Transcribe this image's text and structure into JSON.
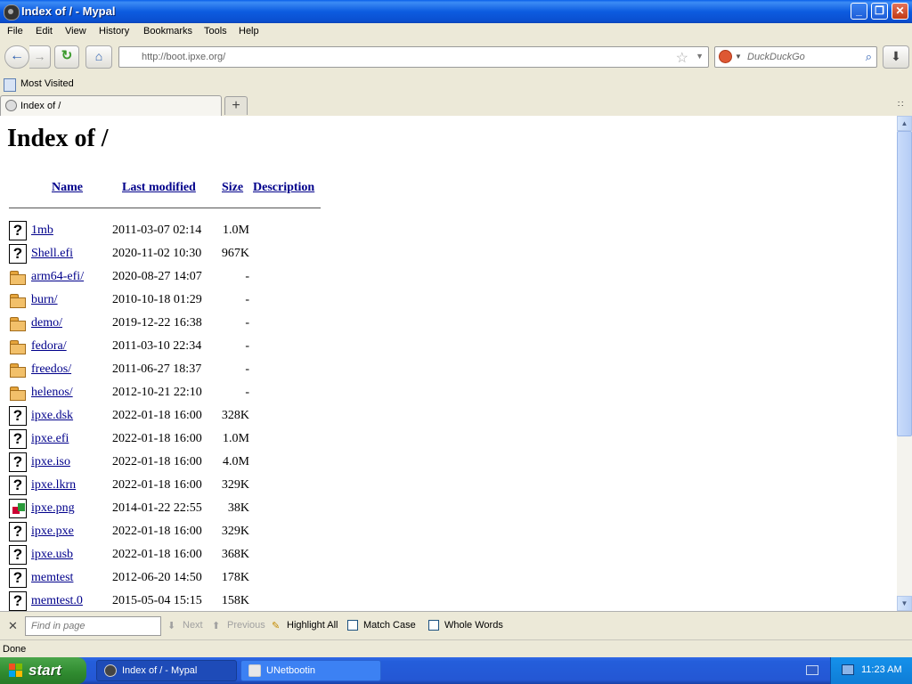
{
  "window": {
    "title": "Index of / - Mypal"
  },
  "menu": [
    "File",
    "Edit",
    "View",
    "History",
    "Bookmarks",
    "Tools",
    "Help"
  ],
  "navbar": {
    "url": "http://boot.ipxe.org/",
    "search_placeholder": "DuckDuckGo"
  },
  "bookmarks": {
    "most_visited": "Most Visited"
  },
  "tabs": [
    {
      "label": "Index of /"
    }
  ],
  "page": {
    "heading": "Index of /",
    "columns": {
      "name": "Name",
      "modified": "Last modified",
      "size": "Size",
      "description": "Description"
    },
    "rows": [
      {
        "icon": "file-icon",
        "name": "1mb",
        "date": "2011-03-07 02:14",
        "size": "1.0M"
      },
      {
        "icon": "file-icon",
        "name": "Shell.efi",
        "date": "2020-11-02 10:30",
        "size": "967K"
      },
      {
        "icon": "folder-icon",
        "name": "arm64-efi/",
        "date": "2020-08-27 14:07",
        "size": "-"
      },
      {
        "icon": "folder-icon",
        "name": "burn/",
        "date": "2010-10-18 01:29",
        "size": "-"
      },
      {
        "icon": "folder-icon",
        "name": "demo/",
        "date": "2019-12-22 16:38",
        "size": "-"
      },
      {
        "icon": "folder-icon",
        "name": "fedora/",
        "date": "2011-03-10 22:34",
        "size": "-"
      },
      {
        "icon": "folder-icon",
        "name": "freedos/",
        "date": "2011-06-27 18:37",
        "size": "-"
      },
      {
        "icon": "folder-icon",
        "name": "helenos/",
        "date": "2012-10-21 22:10",
        "size": "-"
      },
      {
        "icon": "file-icon",
        "name": "ipxe.dsk",
        "date": "2022-01-18 16:00",
        "size": "328K"
      },
      {
        "icon": "file-icon",
        "name": "ipxe.efi",
        "date": "2022-01-18 16:00",
        "size": "1.0M"
      },
      {
        "icon": "file-icon",
        "name": "ipxe.iso",
        "date": "2022-01-18 16:00",
        "size": "4.0M"
      },
      {
        "icon": "file-icon",
        "name": "ipxe.lkrn",
        "date": "2022-01-18 16:00",
        "size": "329K"
      },
      {
        "icon": "image-icon",
        "name": "ipxe.png",
        "date": "2014-01-22 22:55",
        "size": "38K"
      },
      {
        "icon": "file-icon",
        "name": "ipxe.pxe",
        "date": "2022-01-18 16:00",
        "size": "329K"
      },
      {
        "icon": "file-icon",
        "name": "ipxe.usb",
        "date": "2022-01-18 16:00",
        "size": "368K"
      },
      {
        "icon": "file-icon",
        "name": "memtest",
        "date": "2012-06-20 14:50",
        "size": "178K"
      },
      {
        "icon": "file-icon",
        "name": "memtest.0",
        "date": "2015-05-04 15:15",
        "size": "158K"
      }
    ]
  },
  "findbar": {
    "placeholder": "Find in page",
    "next": "Next",
    "previous": "Previous",
    "highlight_all": "Highlight All",
    "match_case": "Match Case",
    "whole_words": "Whole Words"
  },
  "status": {
    "text": "Done"
  },
  "taskbar": {
    "start": "start",
    "items": [
      {
        "label": "Index of / - Mypal"
      },
      {
        "label": "UNetbootin"
      }
    ],
    "clock": "11:23 AM"
  }
}
